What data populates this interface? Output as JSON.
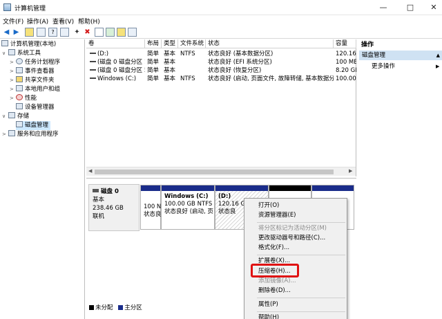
{
  "window": {
    "title": "计算机管理"
  },
  "menu": [
    "文件(F)",
    "操作(A)",
    "查看(V)",
    "帮助(H)"
  ],
  "tree": {
    "root": "计算机管理(本地)",
    "system_tools": "系统工具",
    "task_scheduler": "任务计划程序",
    "event_viewer": "事件查看器",
    "shared_folders": "共享文件夹",
    "local_users": "本地用户和组",
    "performance": "性能",
    "device_manager": "设备管理器",
    "storage": "存储",
    "disk_management": "磁盘管理",
    "services": "服务和应用程序"
  },
  "volumes": {
    "headers": [
      "卷",
      "布局",
      "类型",
      "文件系统",
      "状态",
      "容量"
    ],
    "rows": [
      [
        "(D:)",
        "简单",
        "基本",
        "NTFS",
        "状态良好 (基本数据分区)",
        "120.16"
      ],
      [
        "(磁盘 0 磁盘分区 1)",
        "简单",
        "基本",
        "",
        "状态良好 (EFI 系统分区)",
        "100 ME"
      ],
      [
        "(磁盘 0 磁盘分区 5)",
        "简单",
        "基本",
        "",
        "状态良好 (恢复分区)",
        "8.20 GE"
      ],
      [
        "Windows (C:)",
        "简单",
        "基本",
        "NTFS",
        "状态良好 (启动, 页面文件, 故障转储, 基本数据分区)",
        "100.00"
      ]
    ]
  },
  "disk": {
    "name": "磁盘 0",
    "type": "基本",
    "size": "238.46 GB",
    "status": "联机",
    "parts": {
      "p1_line1": "100 N",
      "p1_line2": "状态良",
      "c_name": "Windows  (C:)",
      "c_size": "100.00 GB NTFS",
      "c_status": "状态良好 (启动, 页",
      "d_name": "(D:)",
      "d_size": "120.16 GB",
      "d_status": "状态良"
    }
  },
  "legend": {
    "unallocated": "未分配",
    "primary": "主分区"
  },
  "actions": {
    "header": "操作",
    "item": "磁盘管理",
    "more": "更多操作"
  },
  "context_menu": {
    "open": "打开(O)",
    "explorer": "资源管理器(E)",
    "mark_active": "将分区标记为活动分区(M)",
    "change_letter": "更改驱动器号和路径(C)...",
    "format": "格式化(F)...",
    "extend": "扩展卷(X)...",
    "shrink": "压缩卷(H)...",
    "add_mirror": "添加镜像(A)...",
    "delete": "删除卷(D)...",
    "properties": "属性(P)",
    "help": "帮助(H)"
  },
  "colors": {
    "primary_partition": "#1a2c8a",
    "unallocated": "#000000",
    "highlight": "#e01010"
  }
}
